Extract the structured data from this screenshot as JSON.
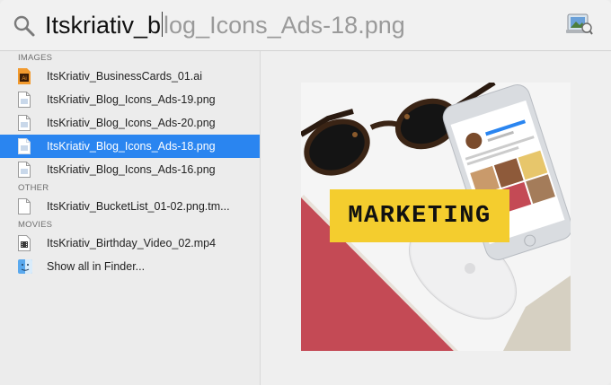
{
  "search": {
    "typed": "Itskriativ_b",
    "completion": "log_Icons_Ads-18.png"
  },
  "sections": [
    {
      "header": "IMAGES",
      "items": [
        {
          "label": "ItsKriativ_BusinessCards_01.ai",
          "icon": "illustrator-file-icon"
        },
        {
          "label": "ItsKriativ_Blog_Icons_Ads-19.png",
          "icon": "png-file-icon"
        },
        {
          "label": "ItsKriativ_Blog_Icons_Ads-20.png",
          "icon": "png-file-icon"
        },
        {
          "label": "ItsKriativ_Blog_Icons_Ads-18.png",
          "icon": "png-file-icon",
          "selected": true
        },
        {
          "label": "ItsKriativ_Blog_Icons_Ads-16.png",
          "icon": "png-file-icon"
        }
      ]
    },
    {
      "header": "OTHER",
      "items": [
        {
          "label": "ItsKriativ_BucketList_01-02.png.tm...",
          "icon": "document-icon"
        }
      ]
    },
    {
      "header": "MOVIES",
      "items": [
        {
          "label": "ItsKriativ_Birthday_Video_02.mp4",
          "icon": "video-file-icon"
        }
      ]
    }
  ],
  "show_all": "Show all in Finder...",
  "preview": {
    "banner_text": "MARKETING"
  },
  "colors": {
    "selection": "#2a85f0",
    "banner": "#f4cd2e",
    "desk_red": "#c44a55"
  }
}
